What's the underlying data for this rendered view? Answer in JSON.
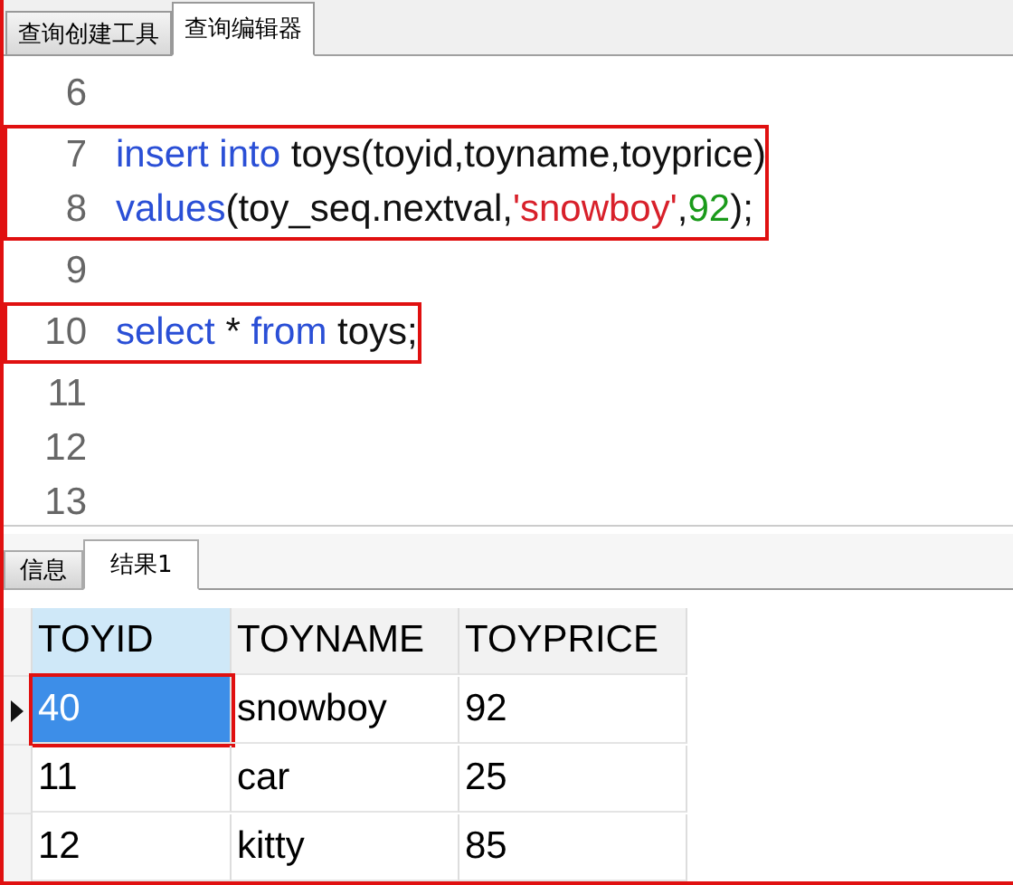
{
  "editor_tabs": [
    {
      "label": "查询创建工具",
      "selected": false
    },
    {
      "label": "查询编辑器",
      "selected": true
    }
  ],
  "code_blocks": [
    {
      "boxed": false,
      "lines": [
        {
          "number": "6"
        }
      ]
    },
    {
      "boxed": true,
      "lines": [
        {
          "number": "7",
          "tokens": [
            {
              "kind": "keyword",
              "text": "insert into"
            },
            {
              "kind": "plain",
              "text": " toys(toyid,toyname,toyprice)"
            }
          ]
        },
        {
          "number": "8",
          "tokens": [
            {
              "kind": "keyword",
              "text": "values"
            },
            {
              "kind": "plain",
              "text": "(toy_seq.nextval,"
            },
            {
              "kind": "string",
              "text": "'snowboy'"
            },
            {
              "kind": "plain",
              "text": ","
            },
            {
              "kind": "number",
              "text": "92"
            },
            {
              "kind": "plain",
              "text": ");"
            }
          ]
        }
      ]
    },
    {
      "boxed": false,
      "lines": [
        {
          "number": "9"
        }
      ]
    },
    {
      "boxed": true,
      "lines": [
        {
          "number": "10",
          "tokens": [
            {
              "kind": "keyword",
              "text": "select"
            },
            {
              "kind": "plain",
              "text": " * "
            },
            {
              "kind": "keyword",
              "text": "from"
            },
            {
              "kind": "plain",
              "text": " toys;"
            }
          ]
        }
      ]
    },
    {
      "boxed": false,
      "lines": [
        {
          "number": "11"
        },
        {
          "number": "12"
        },
        {
          "number": "13"
        }
      ]
    }
  ],
  "result_tabs": [
    {
      "label": "信息",
      "selected": false
    },
    {
      "label": "结果1",
      "selected": true
    }
  ],
  "table": {
    "columns": [
      {
        "label": "TOYID",
        "selected": true
      },
      {
        "label": "TOYNAME",
        "selected": false
      },
      {
        "label": "TOYPRICE",
        "selected": false
      }
    ],
    "rows": [
      {
        "current": true,
        "cells": [
          {
            "text": "40",
            "selected": true,
            "boxed": true
          },
          {
            "text": "snowboy",
            "selected": false,
            "boxed": false
          },
          {
            "text": "92",
            "selected": false,
            "boxed": false
          }
        ]
      },
      {
        "current": false,
        "cells": [
          {
            "text": "11",
            "selected": false,
            "boxed": false
          },
          {
            "text": "car",
            "selected": false,
            "boxed": false
          },
          {
            "text": "25",
            "selected": false,
            "boxed": false
          }
        ]
      },
      {
        "current": false,
        "cells": [
          {
            "text": "12",
            "selected": false,
            "boxed": false
          },
          {
            "text": "kitty",
            "selected": false,
            "boxed": false
          },
          {
            "text": "85",
            "selected": false,
            "boxed": false
          }
        ]
      }
    ]
  }
}
